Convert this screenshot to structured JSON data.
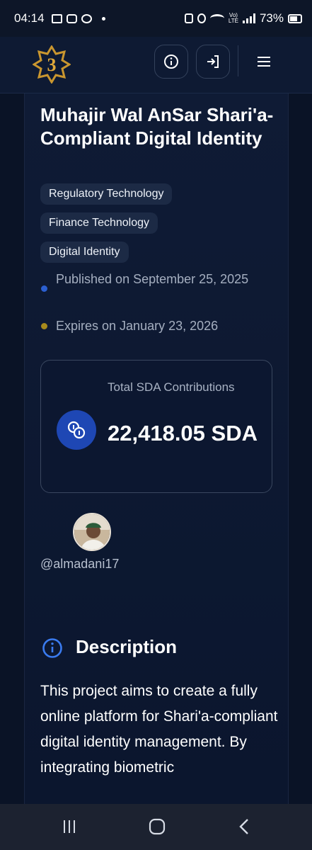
{
  "status_bar": {
    "time": "04:14",
    "battery": "73%"
  },
  "header": {
    "logo_icon": "star-logo-icon",
    "info_icon": "info-icon",
    "login_icon": "login-icon",
    "menu_icon": "hamburger-menu-icon"
  },
  "project": {
    "title": "Muhajir Wal AnSar Shari'a-Compliant Digital Identity",
    "tags": [
      "Regulatory Technology",
      "Finance Technology",
      "Digital Identity"
    ],
    "published": "Published on September 25, 2025",
    "expires": "Expires on January 23, 2026",
    "published_dot_color": "#2b5fd0",
    "expires_dot_color": "#a78a1c"
  },
  "contributions": {
    "label": "Total SDA Contributions",
    "value": "22,418.05 SDA",
    "icon": "coins-icon"
  },
  "author": {
    "username": "@almadani17"
  },
  "description": {
    "title": "Description",
    "body": "This project aims to create a fully online platform for Shari'a-compliant digital identity management. By integrating biometric"
  },
  "navbar": {
    "recents_icon": "recent-apps-icon",
    "home_icon": "home-icon",
    "back_icon": "back-icon"
  }
}
